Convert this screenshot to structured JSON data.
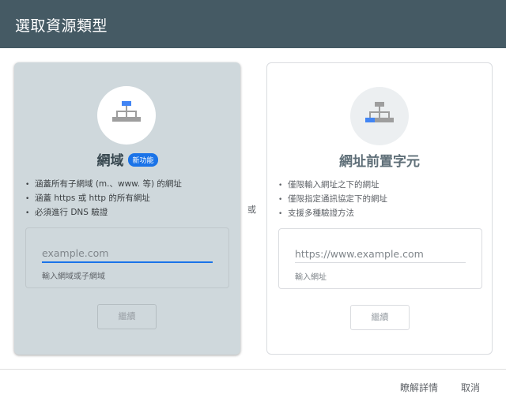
{
  "dialog": {
    "title": "選取資源類型"
  },
  "domain_card": {
    "title": "網域",
    "badge": "新功能",
    "bullets": [
      "涵蓋所有子網域 (m.、www. 等) 的網址",
      "涵蓋 https 或 http 的所有網址",
      "必須進行 DNS 驗證"
    ],
    "input": {
      "placeholder": "example.com",
      "value": "",
      "hint": "輸入網域或子網域"
    },
    "continue_label": "繼續",
    "icon": "sitemap-icon",
    "highlight_color": "#4285f4"
  },
  "separator": {
    "label": "或"
  },
  "prefix_card": {
    "title": "網址前置字元",
    "bullets": [
      "僅限輸入網址之下的網址",
      "僅限指定通訊協定下的網址",
      "支援多種驗證方法"
    ],
    "input": {
      "placeholder": "https://www.example.com",
      "value": "",
      "hint": "輸入網址"
    },
    "continue_label": "繼續",
    "icon": "sitemap-icon",
    "highlight_color": "#4285f4"
  },
  "footer": {
    "learn_more": "瞭解詳情",
    "cancel": "取消"
  }
}
